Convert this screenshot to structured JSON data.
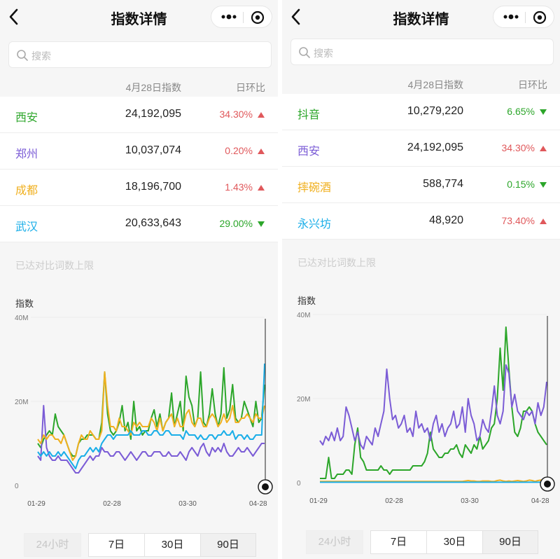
{
  "colors": {
    "red": "#e0585b",
    "green": "#2ca62a",
    "purple": "#7b5cd6",
    "orange": "#f0b020",
    "blue": "#1aaee8"
  },
  "panels": [
    {
      "title": "指数详情",
      "search_placeholder": "搜索",
      "header": {
        "col_index": "4月28日指数",
        "col_change": "日环比"
      },
      "rows": [
        {
          "name": "西安",
          "value": "24,192,095",
          "change": "34.30%",
          "dir": "up",
          "color": "#2ca62a"
        },
        {
          "name": "郑州",
          "value": "10,037,074",
          "change": "0.20%",
          "dir": "up",
          "color": "#7b5cd6"
        },
        {
          "name": "成都",
          "value": "18,196,700",
          "change": "1.43%",
          "dir": "up",
          "color": "#f0b020"
        },
        {
          "name": "武汉",
          "value": "20,633,643",
          "change": "29.00%",
          "dir": "down",
          "color": "#1aaee8"
        }
      ],
      "limit_text": "已达对比词数上限",
      "chart_ylabel": "指数",
      "chart_data": {
        "type": "line",
        "ylabel": "指数",
        "y_ticks": [
          "40M",
          "20M",
          "0"
        ],
        "ylim": [
          0,
          40
        ],
        "x_ticks": [
          "01-29",
          "02-28",
          "03-30",
          "04-28"
        ],
        "series": [
          {
            "name": "西安",
            "color": "#2ca62a",
            "values": [
              10,
              9,
              11,
              12,
              13,
              12,
              17,
              14,
              13,
              12,
              10,
              8,
              7,
              7,
              10,
              11,
              11,
              12,
              12,
              12,
              11,
              11,
              15,
              27,
              17,
              13,
              12,
              13,
              15,
              19,
              13,
              15,
              11,
              20,
              13,
              14,
              12,
              13,
              13,
              16,
              18,
              14,
              17,
              13,
              15,
              16,
              22,
              14,
              17,
              20,
              13,
              26,
              21,
              19,
              14,
              16,
              27,
              15,
              14,
              17,
              23,
              17,
              14,
              17,
              28,
              16,
              18,
              24,
              16,
              15,
              16,
              20,
              18,
              16,
              14,
              20,
              15,
              16,
              24
            ]
          },
          {
            "name": "郑州",
            "color": "#7b5cd6",
            "values": [
              7,
              6,
              19,
              9,
              7,
              6,
              6,
              7,
              6,
              6,
              6,
              5,
              4,
              3,
              3,
              4,
              5,
              6,
              7,
              6,
              7,
              7,
              9,
              8,
              8,
              7,
              7,
              8,
              8,
              7,
              6,
              7,
              8,
              7,
              6,
              7,
              8,
              8,
              7,
              7,
              8,
              8,
              8,
              7,
              7,
              8,
              7,
              7,
              7,
              8,
              7,
              6,
              8,
              9,
              8,
              7,
              9,
              10,
              8,
              7,
              9,
              8,
              9,
              8,
              10,
              8,
              7,
              7,
              8,
              9,
              8,
              8,
              9,
              8,
              7,
              8,
              9,
              10,
              10
            ]
          },
          {
            "name": "成都",
            "color": "#f0b020",
            "values": [
              11,
              10,
              12,
              11,
              12,
              12,
              11,
              11,
              10,
              12,
              10,
              8,
              6,
              7,
              10,
              12,
              11,
              11,
              13,
              12,
              11,
              11,
              13,
              27,
              19,
              14,
              14,
              13,
              16,
              14,
              14,
              13,
              12,
              15,
              14,
              15,
              14,
              14,
              14,
              16,
              15,
              13,
              16,
              13,
              15,
              16,
              17,
              14,
              16,
              14,
              14,
              17,
              18,
              15,
              14,
              16,
              16,
              14,
              14,
              16,
              17,
              16,
              14,
              15,
              17,
              15,
              16,
              19,
              15,
              15,
              16,
              16,
              17,
              16,
              15,
              17,
              16,
              16,
              19
            ]
          },
          {
            "name": "武汉",
            "color": "#1aaee8",
            "values": [
              8,
              7,
              8,
              7,
              8,
              7,
              7,
              8,
              7,
              8,
              7,
              6,
              5,
              4,
              6,
              7,
              7,
              8,
              9,
              8,
              9,
              8,
              10,
              11,
              12,
              12,
              11,
              12,
              12,
              12,
              12,
              12,
              13,
              12,
              12,
              12,
              13,
              13,
              12,
              12,
              13,
              13,
              12,
              12,
              13,
              13,
              12,
              12,
              12,
              12,
              11,
              13,
              12,
              12,
              12,
              11,
              12,
              11,
              11,
              12,
              12,
              11,
              12,
              12,
              13,
              12,
              12,
              13,
              11,
              12,
              12,
              11,
              12,
              11,
              11,
              12,
              12,
              12,
              29
            ]
          }
        ]
      },
      "time_buttons": [
        "24小时",
        "7日",
        "30日",
        "90日"
      ]
    },
    {
      "title": "指数详情",
      "search_placeholder": "搜索",
      "header": {
        "col_index": "4月28日指数",
        "col_change": "日环比"
      },
      "rows": [
        {
          "name": "抖音",
          "value": "10,279,220",
          "change": "6.65%",
          "dir": "down",
          "color": "#2ca62a"
        },
        {
          "name": "西安",
          "value": "24,192,095",
          "change": "34.30%",
          "dir": "up",
          "color": "#7b5cd6"
        },
        {
          "name": "摔碗酒",
          "value": "588,774",
          "change": "0.15%",
          "dir": "down",
          "color": "#f0b020"
        },
        {
          "name": "永兴坊",
          "value": "48,920",
          "change": "73.40%",
          "dir": "up",
          "color": "#1aaee8"
        }
      ],
      "limit_text": "已达对比词数上限",
      "chart_ylabel": "指数",
      "chart_data": {
        "type": "line",
        "ylabel": "指数",
        "y_ticks": [
          "40M",
          "20M",
          "0"
        ],
        "ylim": [
          0,
          40
        ],
        "x_ticks": [
          "01-29",
          "02-28",
          "03-30",
          "04-28"
        ],
        "series": [
          {
            "name": "抖音",
            "color": "#2ca62a",
            "values": [
              1,
              1,
              1,
              6,
              1,
              1,
              2,
              2,
              2,
              3,
              3,
              2,
              9,
              13,
              6,
              5,
              3,
              3,
              3,
              3,
              3,
              4,
              3,
              3,
              2,
              3,
              3,
              3,
              3,
              3,
              3,
              3,
              4,
              4,
              4,
              4,
              5,
              7,
              12,
              8,
              7,
              6,
              6,
              7,
              7,
              8,
              8,
              9,
              7,
              6,
              9,
              8,
              7,
              9,
              8,
              11,
              8,
              9,
              10,
              13,
              14,
              20,
              32,
              22,
              37,
              27,
              18,
              12,
              11,
              13,
              17,
              17,
              18,
              17,
              14,
              12,
              11,
              10,
              9
            ]
          },
          {
            "name": "西安",
            "color": "#7b5cd6",
            "values": [
              10,
              9,
              11,
              10,
              12,
              10,
              13,
              10,
              11,
              18,
              16,
              13,
              10,
              12,
              9,
              8,
              11,
              10,
              9,
              13,
              11,
              14,
              17,
              27,
              20,
              15,
              16,
              13,
              14,
              16,
              12,
              13,
              11,
              17,
              13,
              14,
              12,
              13,
              10,
              14,
              16,
              12,
              14,
              11,
              13,
              14,
              17,
              13,
              14,
              18,
              12,
              20,
              16,
              14,
              10,
              11,
              15,
              13,
              12,
              17,
              23,
              16,
              14,
              17,
              28,
              26,
              18,
              21,
              17,
              16,
              15,
              17,
              16,
              17,
              14,
              19,
              16,
              18,
              24
            ]
          },
          {
            "name": "摔碗酒",
            "color": "#f0b020",
            "values": [
              0.3,
              0.3,
              0.3,
              0.3,
              0.3,
              0.3,
              0.3,
              0.3,
              0.3,
              0.3,
              0.3,
              0.3,
              0.3,
              0.3,
              0.3,
              0.3,
              0.3,
              0.3,
              0.3,
              0.3,
              0.3,
              0.3,
              0.3,
              0.3,
              0.3,
              0.3,
              0.3,
              0.3,
              0.3,
              0.3,
              0.3,
              0.3,
              0.3,
              0.3,
              0.3,
              0.3,
              0.3,
              0.3,
              0.3,
              0.3,
              0.3,
              0.3,
              0.3,
              0.3,
              0.3,
              0.3,
              0.3,
              0.3,
              0.3,
              0.3,
              0.4,
              0.5,
              0.4,
              0.4,
              0.3,
              0.3,
              0.4,
              0.4,
              0.4,
              0.3,
              0.3,
              0.5,
              0.6,
              0.4,
              0.3,
              0.4,
              0.3,
              0.4,
              0.5,
              0.4,
              0.3,
              0.4,
              0.6,
              0.5,
              0.3,
              0.5,
              0.6,
              0.4,
              0.6
            ]
          },
          {
            "name": "永兴坊",
            "color": "#1aaee8",
            "values": [
              0.1,
              0.1,
              0.1,
              0.1,
              0.1,
              0.1,
              0.1,
              0.1,
              0.1,
              0.1,
              0.1,
              0.1,
              0.1,
              0.1,
              0.1,
              0.1,
              0.1,
              0.1,
              0.1,
              0.1,
              0.1,
              0.1,
              0.1,
              0.1,
              0.1,
              0.1,
              0.1,
              0.1,
              0.1,
              0.1,
              0.1,
              0.1,
              0.1,
              0.1,
              0.1,
              0.1,
              0.1,
              0.1,
              0.1,
              0.1,
              0.1,
              0.1,
              0.1,
              0.1,
              0.1,
              0.1,
              0.1,
              0.1,
              0.1,
              0.1,
              0.1,
              0.1,
              0.1,
              0.1,
              0.1,
              0.1,
              0.1,
              0.1,
              0.1,
              0.1,
              0.1,
              0.1,
              0.1,
              0.1,
              0.1,
              0.1,
              0.1,
              0.1,
              0.1,
              0.1,
              0.1,
              0.1,
              0.1,
              0.1,
              0.1,
              0.1,
              0.1,
              0.1,
              0.1
            ]
          }
        ]
      },
      "time_buttons": [
        "24小时",
        "7日",
        "30日",
        "90日"
      ]
    }
  ]
}
